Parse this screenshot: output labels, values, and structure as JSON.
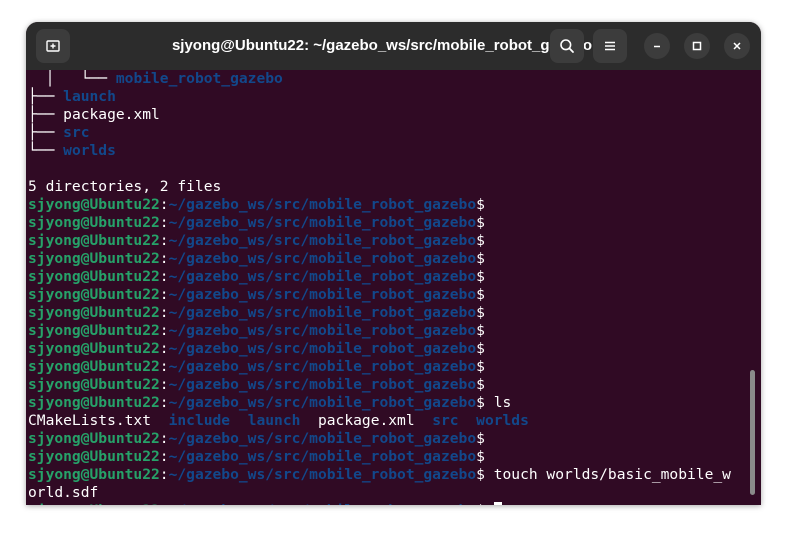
{
  "window": {
    "title": "sjyong@Ubuntu22: ~/gazebo_ws/src/mobile_robot_gazebo"
  },
  "titlebar": {
    "new_tab_icon": "new-tab-icon",
    "search_icon": "search-icon",
    "menu_icon": "hamburger-menu-icon",
    "minimize_icon": "minimize-icon",
    "maximize_icon": "maximize-icon",
    "close_icon": "close-icon"
  },
  "colors": {
    "terminal_bg": "#300a24",
    "user_host": "#26a269",
    "path_and_dirs": "#12488b",
    "text": "#ffffff",
    "titlebar": "#2c2c2c"
  },
  "terminal": {
    "prompt_user": "sjyong@Ubuntu22",
    "prompt_sep": ":",
    "prompt_path": "~/gazebo_ws/src/mobile_robot_gazebo",
    "prompt_dollar": "$",
    "tree": {
      "line0_prefix": "  │   └── ",
      "line0_name": "mobile_robot_gazebo",
      "entries": [
        {
          "prefix": "├── ",
          "name": "launch",
          "dir": true
        },
        {
          "prefix": "├── ",
          "name": "package.xml",
          "dir": false
        },
        {
          "prefix": "├── ",
          "name": "src",
          "dir": true
        },
        {
          "prefix": "└── ",
          "name": "worlds",
          "dir": true
        }
      ],
      "summary": "5 directories, 2 files"
    },
    "empty_prompts_a": 11,
    "ls_command": " ls",
    "ls_output": [
      {
        "name": "CMakeLists.txt",
        "dir": false
      },
      {
        "name": "include",
        "dir": true
      },
      {
        "name": "launch",
        "dir": true
      },
      {
        "name": "package.xml",
        "dir": false
      },
      {
        "name": "src",
        "dir": true
      },
      {
        "name": "worlds",
        "dir": true
      }
    ],
    "empty_prompts_b": 2,
    "touch_command_line1": " touch worlds/basic_mobile_w",
    "touch_command_line2": "orld.sdf"
  }
}
